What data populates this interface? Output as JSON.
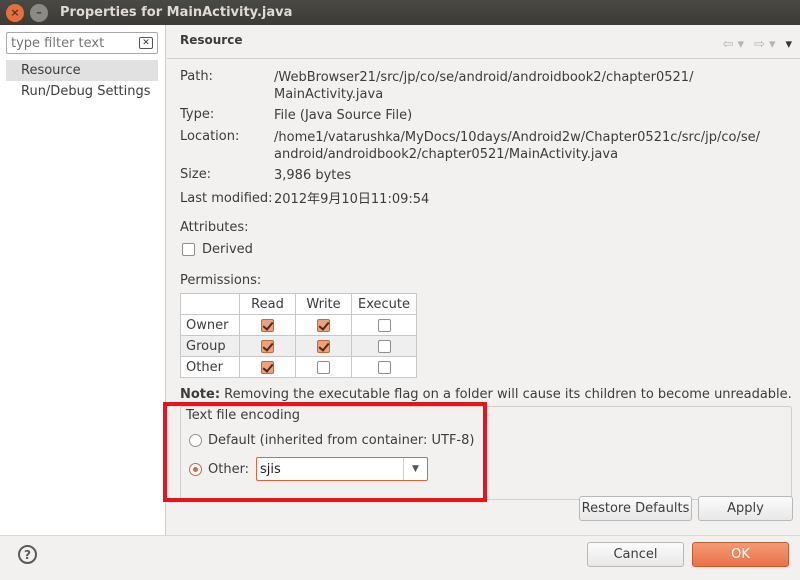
{
  "window": {
    "title": "Properties for MainActivity.java",
    "close_glyph": "×",
    "minimize_glyph": "–"
  },
  "sidebar": {
    "filter_placeholder": "type filter text",
    "items": [
      {
        "label": "Resource",
        "selected": true
      },
      {
        "label": "Run/Debug Settings",
        "selected": false
      }
    ]
  },
  "header": {
    "title": "Resource"
  },
  "properties": {
    "path_label": "Path:",
    "path_value_1": "/WebBrowser21/src/jp/co/se/android/androidbook2/chapter0521/",
    "path_value_2": "MainActivity.java",
    "type_label": "Type:",
    "type_value": "File  (Java Source File)",
    "location_label": "Location:",
    "location_value_1": "/home1/vatarushka/MyDocs/10days/Android2w/Chapter0521c/src/jp/co/se/",
    "location_value_2": "android/androidbook2/chapter0521/MainActivity.java",
    "size_label": "Size:",
    "size_value": "3,986  bytes",
    "modified_label": "Last modified:",
    "modified_value": "2012年9月10日11:09:54"
  },
  "attributes": {
    "label": "Attributes:",
    "derived_label": "Derived",
    "derived_checked": false
  },
  "permissions": {
    "label": "Permissions:",
    "columns": [
      "Read",
      "Write",
      "Execute"
    ],
    "rows": [
      {
        "label": "Owner",
        "read": true,
        "write": true,
        "execute": false
      },
      {
        "label": "Group",
        "read": true,
        "write": true,
        "execute": false
      },
      {
        "label": "Other",
        "read": true,
        "write": false,
        "execute": false
      }
    ]
  },
  "note": {
    "bold": "Note:",
    "text": " Removing the executable flag on a folder will cause its children to become unreadable."
  },
  "encoding": {
    "title": "Text file encoding",
    "default_label": "Default (inherited from container: UTF-8)",
    "other_label": "Other:",
    "other_value": "sjis",
    "selected": "other"
  },
  "buttons": {
    "restore_defaults": "Restore Defaults",
    "apply": "Apply",
    "cancel": "Cancel",
    "ok": "OK",
    "help": "?"
  },
  "colors": {
    "accent": "#e8734a",
    "highlight_box": "#e8141c"
  }
}
